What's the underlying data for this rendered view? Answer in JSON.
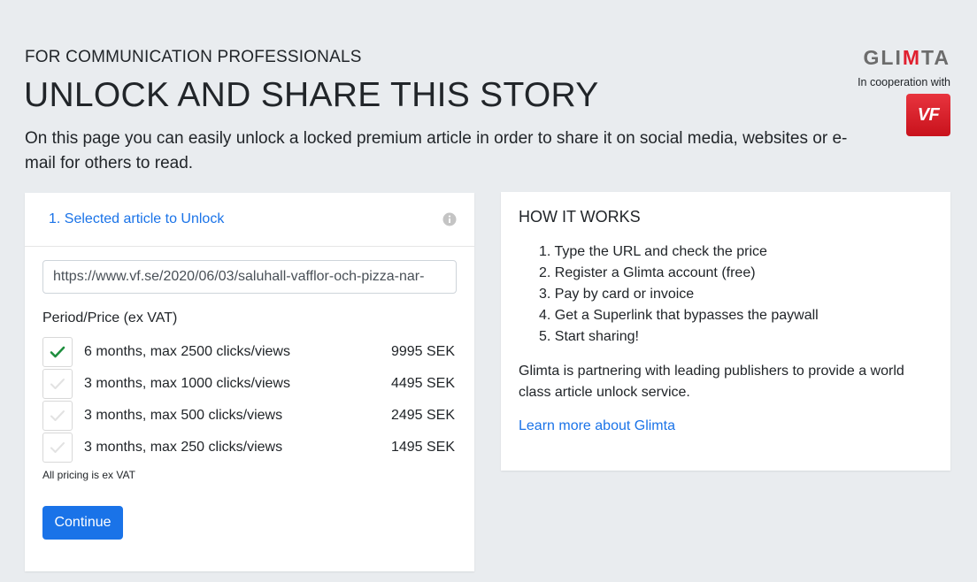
{
  "header": {
    "eyebrow": "FOR COMMUNICATION PROFESSIONALS",
    "title": "UNLOCK AND SHARE THIS STORY",
    "lead": "On this page you can easily unlock a locked premium article in order to share it on social media, websites or e-mail for others to read."
  },
  "brand": {
    "logo_prefix": "GLI",
    "logo_accent": "M",
    "logo_suffix": "TA",
    "cooperation_label": "In cooperation with",
    "partner_badge": "VF",
    "accent_color": "#e0202f"
  },
  "unlock_card": {
    "header_title": "1. Selected article to Unlock",
    "info_icon": "info-icon",
    "url_value": "https://www.vf.se/2020/06/03/saluhall-vafflor-och-pizza-nar-",
    "period_label": "Period/Price (ex VAT)",
    "options": [
      {
        "label": "6 months, max 2500 clicks/views",
        "price": "9995 SEK",
        "checked": true
      },
      {
        "label": "3 months, max 1000 clicks/views",
        "price": "4495 SEK",
        "checked": false
      },
      {
        "label": "3 months, max 500 clicks/views",
        "price": "2495 SEK",
        "checked": false
      },
      {
        "label": "3 months, max 250 clicks/views",
        "price": "1495 SEK",
        "checked": false
      }
    ],
    "note": "All pricing is ex VAT",
    "continue_label": "Continue"
  },
  "how_card": {
    "title": "HOW IT WORKS",
    "steps": [
      "1. Type the URL and check the price",
      "2. Register a Glimta account (free)",
      "3. Pay by card or invoice",
      "4. Get a Superlink that bypasses the paywall",
      "5. Start sharing!"
    ],
    "partner_text": "Glimta is partnering with leading publishers to provide a world class article unlock service.",
    "learn_more": "Learn more about Glimta"
  },
  "colors": {
    "background": "#e9ecef",
    "link": "#1a73e8",
    "check_active": "#1e8e3e",
    "check_inactive": "#e2e2e2"
  }
}
